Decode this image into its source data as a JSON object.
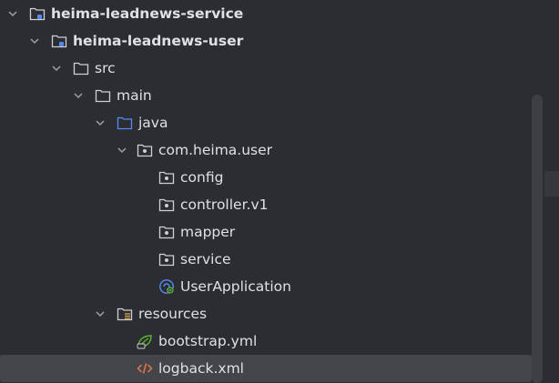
{
  "tree": {
    "items": [
      {
        "label": "heima-leadnews-service",
        "icon": "module-icon"
      },
      {
        "label": "heima-leadnews-user",
        "icon": "module-icon"
      },
      {
        "label": "src",
        "icon": "folder-icon"
      },
      {
        "label": "main",
        "icon": "folder-icon"
      },
      {
        "label": "java",
        "icon": "source-folder-icon"
      },
      {
        "label": "com.heima.user",
        "icon": "package-icon"
      },
      {
        "label": "config",
        "icon": "package-icon"
      },
      {
        "label": "controller.v1",
        "icon": "package-icon"
      },
      {
        "label": "mapper",
        "icon": "package-icon"
      },
      {
        "label": "service",
        "icon": "package-icon"
      },
      {
        "label": "UserApplication",
        "icon": "spring-boot-app-icon"
      },
      {
        "label": "resources",
        "icon": "resources-folder-icon"
      },
      {
        "label": "bootstrap.yml",
        "icon": "spring-yaml-icon"
      },
      {
        "label": "logback.xml",
        "icon": "xml-icon"
      }
    ],
    "selected_item": "logback.xml"
  },
  "colors": {
    "background": "#2b2d30",
    "text": "#dfe1e5",
    "selection": "#43454a",
    "source_folder": "#548af7",
    "spring": "#5fb832",
    "xml": "#e8754a"
  }
}
